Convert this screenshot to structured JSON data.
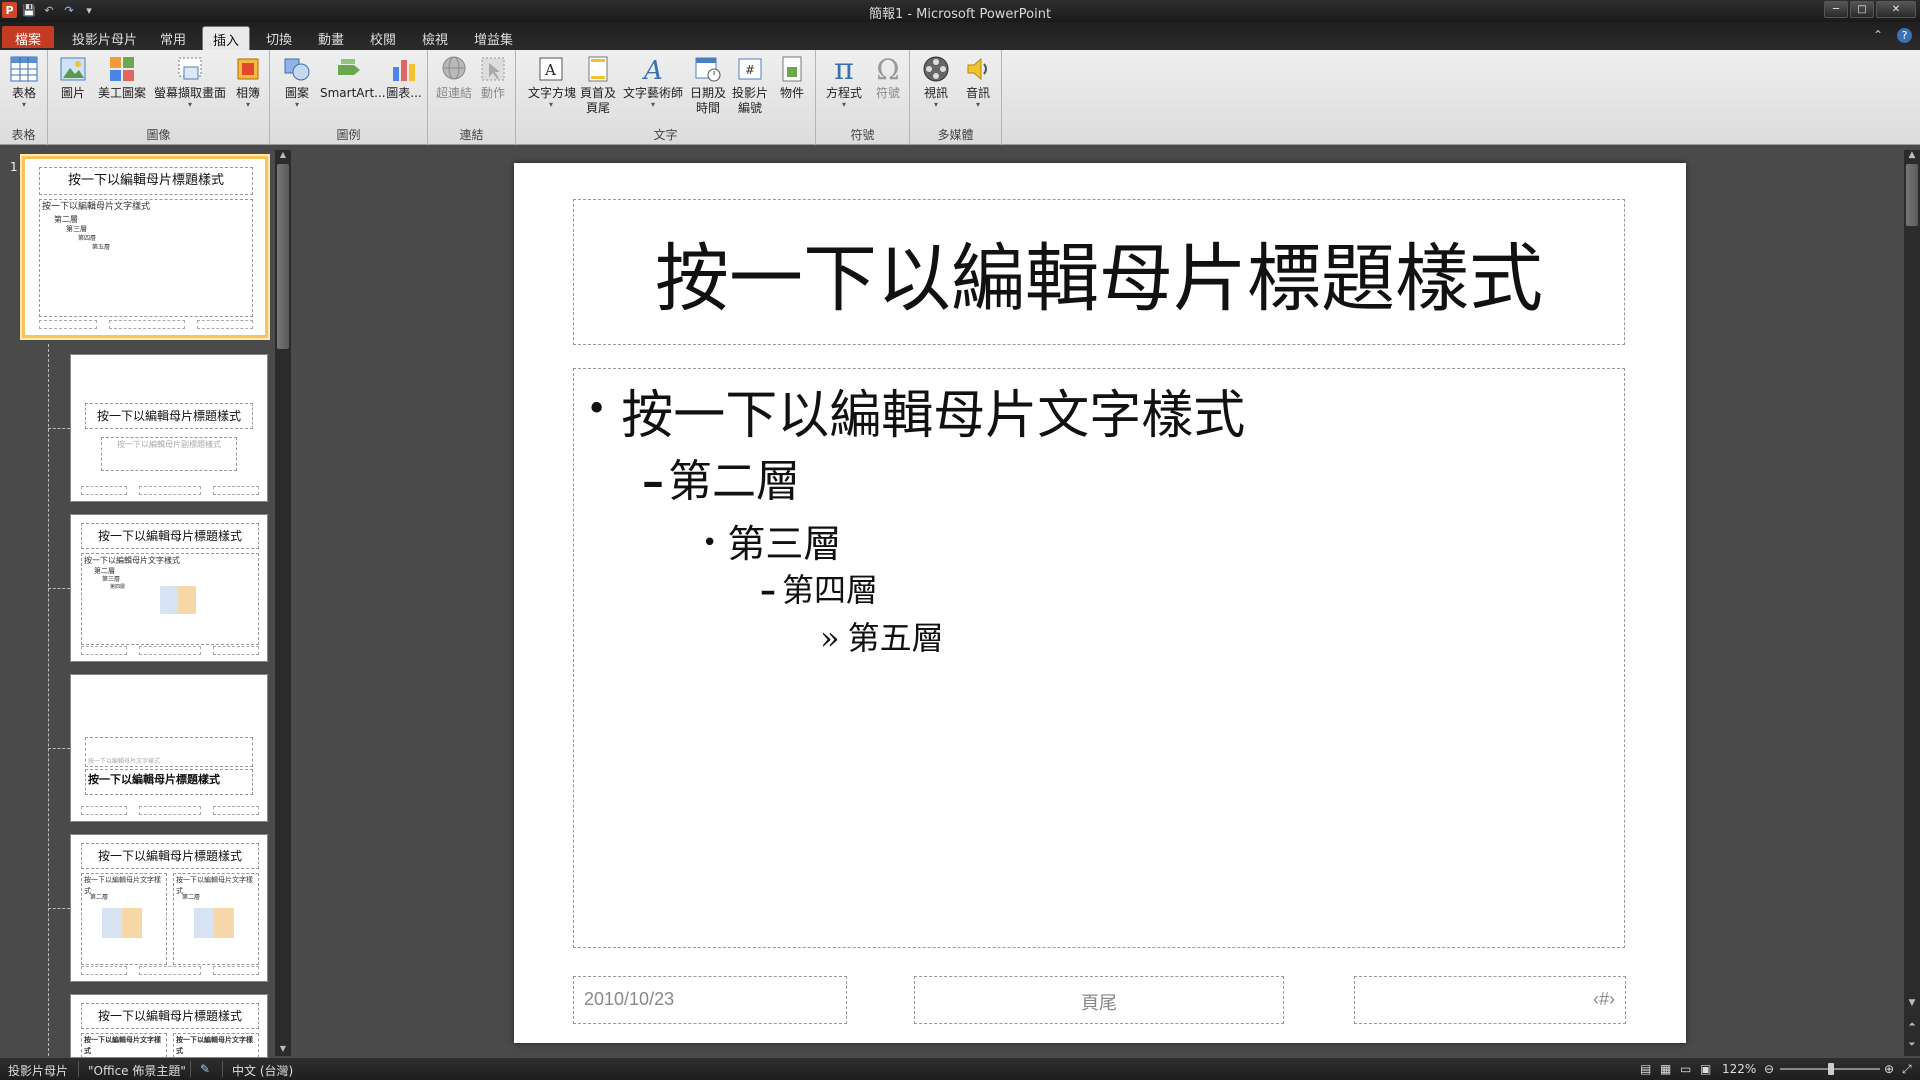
{
  "window": {
    "title": "簡報1 - Microsoft PowerPoint",
    "minimize": "─",
    "maximize": "□",
    "close": "✕"
  },
  "qat": {
    "save": "💾",
    "undo": "↶",
    "redo": "↷",
    "customize": "▾",
    "app_icon": "P"
  },
  "tabs": [
    {
      "label": "檔案"
    },
    {
      "label": "投影片母片"
    },
    {
      "label": "常用"
    },
    {
      "label": "插入"
    },
    {
      "label": "切換"
    },
    {
      "label": "動畫"
    },
    {
      "label": "校閱"
    },
    {
      "label": "檢視"
    },
    {
      "label": "增益集"
    }
  ],
  "ribbon": {
    "groups": [
      {
        "label": "表格"
      },
      {
        "label": "圖像"
      },
      {
        "label": "圖例"
      },
      {
        "label": "連結"
      },
      {
        "label": "文字"
      },
      {
        "label": "符號"
      },
      {
        "label": "多媒體"
      }
    ],
    "buttons": {
      "table": "表格",
      "picture": "圖片",
      "clipart": "美工圖案",
      "screenshot": "螢幕擷取畫面",
      "album": "相簿",
      "shapes": "圖案",
      "smartart": "SmartArt...",
      "chart": "圖表...",
      "hyperlink": "超連結",
      "action": "動作",
      "textbox": "文字方塊",
      "header_footer_1": "頁首及",
      "header_footer_2": "頁尾",
      "wordart": "文字藝術師",
      "datetime_1": "日期及",
      "datetime_2": "時間",
      "slidenum_1": "投影片",
      "slidenum_2": "編號",
      "object": "物件",
      "equation": "方程式",
      "symbol": "符號",
      "video": "視訊",
      "audio": "音訊"
    }
  },
  "thumbnails": {
    "first_number": "1",
    "master_title": "按一下以編輯母片標題樣式",
    "master_text": "按一下以編輯母片文字樣式",
    "level2": "第二層",
    "level3": "第三層",
    "level4": "第四層",
    "level5": "第五層",
    "subtitle_hint": "按一下以編輯母片副標題樣式"
  },
  "slide": {
    "title": "按一下以編輯母片標題樣式",
    "levels": [
      "按一下以編輯母片文字樣式",
      "第二層",
      "第三層",
      "第四層",
      "第五層"
    ],
    "markers": [
      "•",
      "–",
      "•",
      "–",
      "»"
    ],
    "date": "2010/10/23",
    "footer": "頁尾",
    "slide_number": "‹#›"
  },
  "statusbar": {
    "view": "投影片母片",
    "theme": "\"Office 佈景主題\"",
    "language": "中文 (台灣)",
    "zoom": "122%"
  },
  "colors": {
    "file_tab": "#c23b22",
    "selected_thumb": "#f5c45a",
    "ribbon_bg": "#e6e6e6",
    "workspace": "#4a4a4a"
  }
}
